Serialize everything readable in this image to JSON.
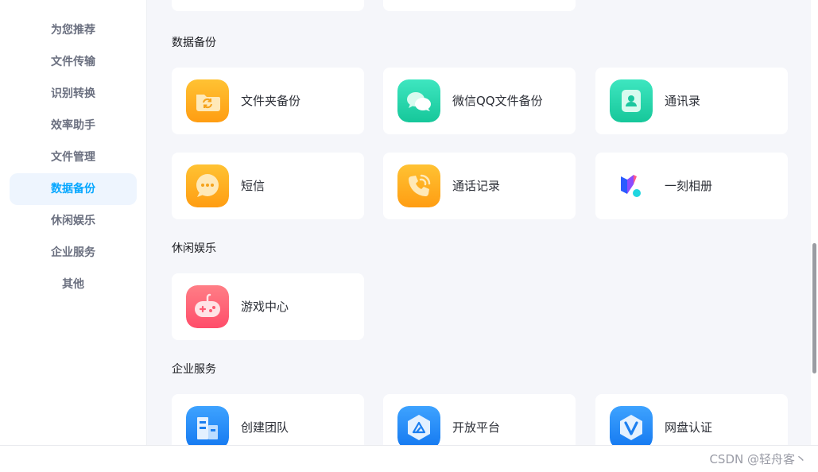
{
  "sidebar": {
    "items": [
      {
        "label": "为您推荐"
      },
      {
        "label": "文件传输"
      },
      {
        "label": "识别转换"
      },
      {
        "label": "效率助手"
      },
      {
        "label": "文件管理"
      },
      {
        "label": "数据备份",
        "active": true
      },
      {
        "label": "休闲娱乐"
      },
      {
        "label": "企业服务"
      },
      {
        "label": "其他"
      }
    ]
  },
  "sections": {
    "backup": {
      "title": "数据备份",
      "cards": [
        {
          "label": "文件夹备份",
          "icon": "folder-sync-icon"
        },
        {
          "label": "微信QQ文件备份",
          "icon": "chat-bubbles-icon"
        },
        {
          "label": "通讯录",
          "icon": "contact-icon"
        },
        {
          "label": "短信",
          "icon": "sms-icon"
        },
        {
          "label": "通话记录",
          "icon": "phone-icon"
        },
        {
          "label": "一刻相册",
          "icon": "yike-album-icon"
        }
      ]
    },
    "leisure": {
      "title": "休闲娱乐",
      "cards": [
        {
          "label": "游戏中心",
          "icon": "gamepad-icon"
        }
      ]
    },
    "enterprise": {
      "title": "企业服务",
      "cards": [
        {
          "label": "创建团队",
          "icon": "building-icon"
        },
        {
          "label": "开放平台",
          "icon": "open-platform-icon"
        },
        {
          "label": "网盘认证",
          "icon": "verified-shield-icon"
        }
      ]
    }
  },
  "footer": {
    "watermark": "CSDN @轻舟客丶"
  },
  "colors": {
    "accent": "#06a7ff",
    "nav_active_bg": "#eef5fe",
    "content_bg": "#f5f6fa"
  }
}
